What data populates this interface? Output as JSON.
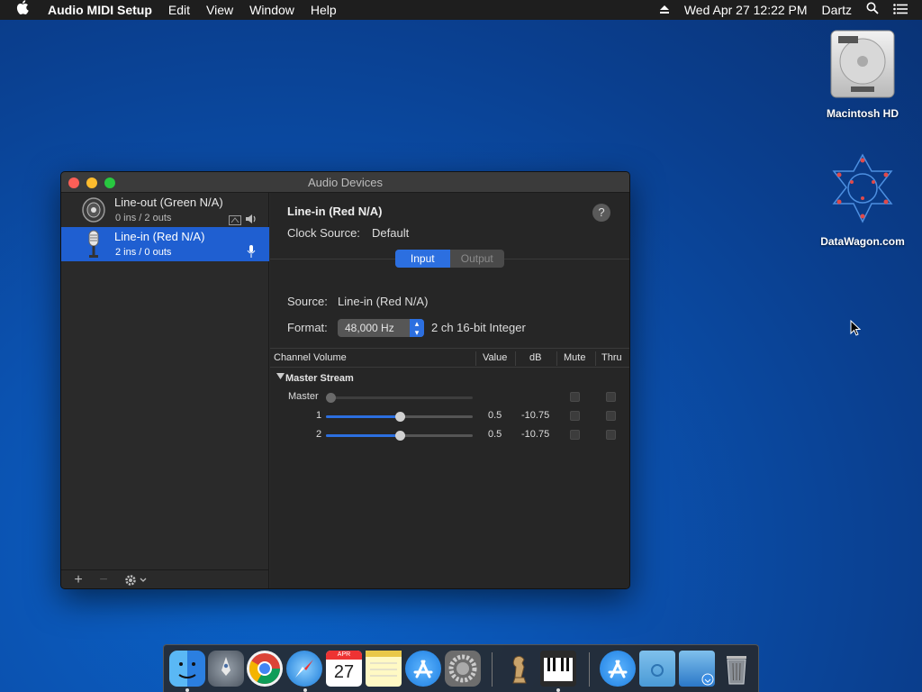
{
  "menubar": {
    "app_name": "Audio MIDI Setup",
    "menus": [
      "Edit",
      "View",
      "Window",
      "Help"
    ],
    "clock": "Wed Apr 27  12:22 PM",
    "user": "Dartz"
  },
  "desktop": {
    "icons": [
      {
        "label": "Macintosh HD",
        "icon": "hard-drive-icon"
      },
      {
        "label": "DataWagon.com",
        "icon": "datawagon-logo-icon"
      }
    ]
  },
  "window": {
    "title": "Audio Devices",
    "devices": [
      {
        "name": "Line-out (Green N/A)",
        "io": "0 ins / 2 outs",
        "icon": "speaker-icon",
        "selected": false
      },
      {
        "name": "Line-in (Red N/A)",
        "io": "2 ins / 0 outs",
        "icon": "microphone-icon",
        "selected": true
      }
    ],
    "detail": {
      "device_name": "Line-in (Red N/A)",
      "clock_source_label": "Clock Source:",
      "clock_source_value": "Default",
      "tabs": [
        "Input",
        "Output"
      ],
      "active_tab": "Input",
      "source_label": "Source:",
      "source_value": "Line-in (Red N/A)",
      "format_label": "Format:",
      "format_rate": "48,000 Hz",
      "format_desc": "2 ch 16-bit Integer",
      "table_headers": [
        "Channel Volume",
        "Value",
        "dB",
        "Mute",
        "Thru"
      ],
      "stream_label": "Master Stream",
      "channels": [
        {
          "label": "Master",
          "value": "",
          "db": "",
          "level": 0.0
        },
        {
          "label": "1",
          "value": "0.5",
          "db": "-10.75",
          "level": 0.5
        },
        {
          "label": "2",
          "value": "0.5",
          "db": "-10.75",
          "level": 0.5
        }
      ]
    }
  },
  "dock": {
    "apps": [
      "Finder",
      "Launchpad",
      "Google Chrome",
      "Safari",
      "Calendar",
      "Notes",
      "App Store",
      "System Preferences",
      "Chess",
      "Audio MIDI Setup",
      "Applications",
      "Documents",
      "Downloads",
      "Trash"
    ],
    "calendar_month": "APR",
    "calendar_day": "27"
  },
  "colors": {
    "accent": "#2c6fe0",
    "selection": "#1f5fd1"
  }
}
